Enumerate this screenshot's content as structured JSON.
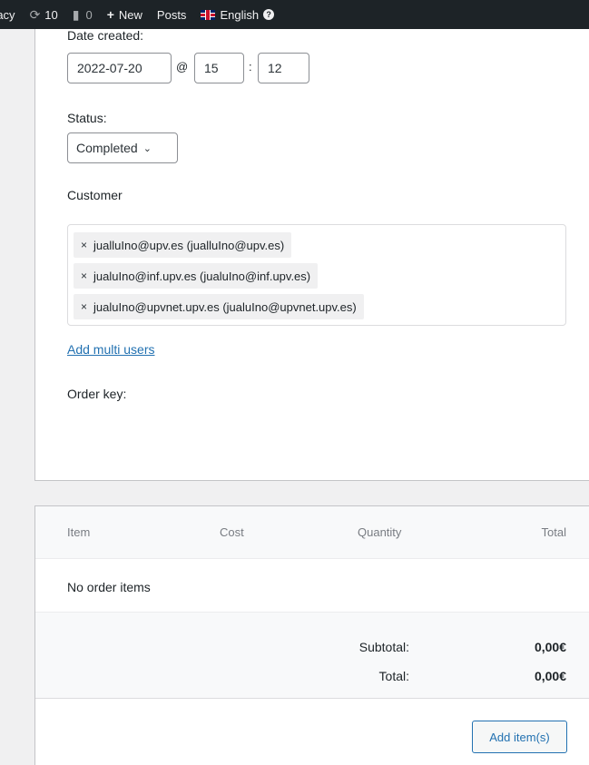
{
  "adminbar": {
    "site_fragment": "racy",
    "updates_count": "10",
    "comments_count": "0",
    "new_label": "New",
    "posts_label": "Posts",
    "language_label": "English",
    "icons": {
      "updates": "refresh-icon",
      "comments": "comment-icon",
      "new": "plus-icon",
      "help": "question-icon"
    }
  },
  "order": {
    "date_label": "Date created:",
    "date_value": "2022-07-20",
    "at_sep": "@",
    "hour_value": "15",
    "colon_sep": ":",
    "minute_value": "12",
    "status_label": "Status:",
    "status_value": "Completed",
    "customer_label": "Customer",
    "customers": [
      "jualluIno@upv.es (jualluIno@upv.es)",
      "jualuIno@inf.upv.es (jualuIno@inf.upv.es)",
      "jualuIno@upvnet.upv.es (jualuIno@upvnet.upv.es)"
    ],
    "token_remove": "×",
    "add_multi_users": "Add multi users",
    "order_key_label": "Order key:"
  },
  "items": {
    "headers": [
      "Item",
      "Cost",
      "Quantity",
      "Total"
    ],
    "empty_text": "No order items",
    "subtotal_label": "Subtotal:",
    "subtotal_value": "0,00€",
    "total_label": "Total:",
    "total_value": "0,00€",
    "add_button": "Add item(s)"
  },
  "colors": {
    "adminbar_bg": "#1d2327",
    "link": "#2271b1",
    "panel_bg": "#ffffff",
    "page_bg": "#f0f0f1"
  }
}
